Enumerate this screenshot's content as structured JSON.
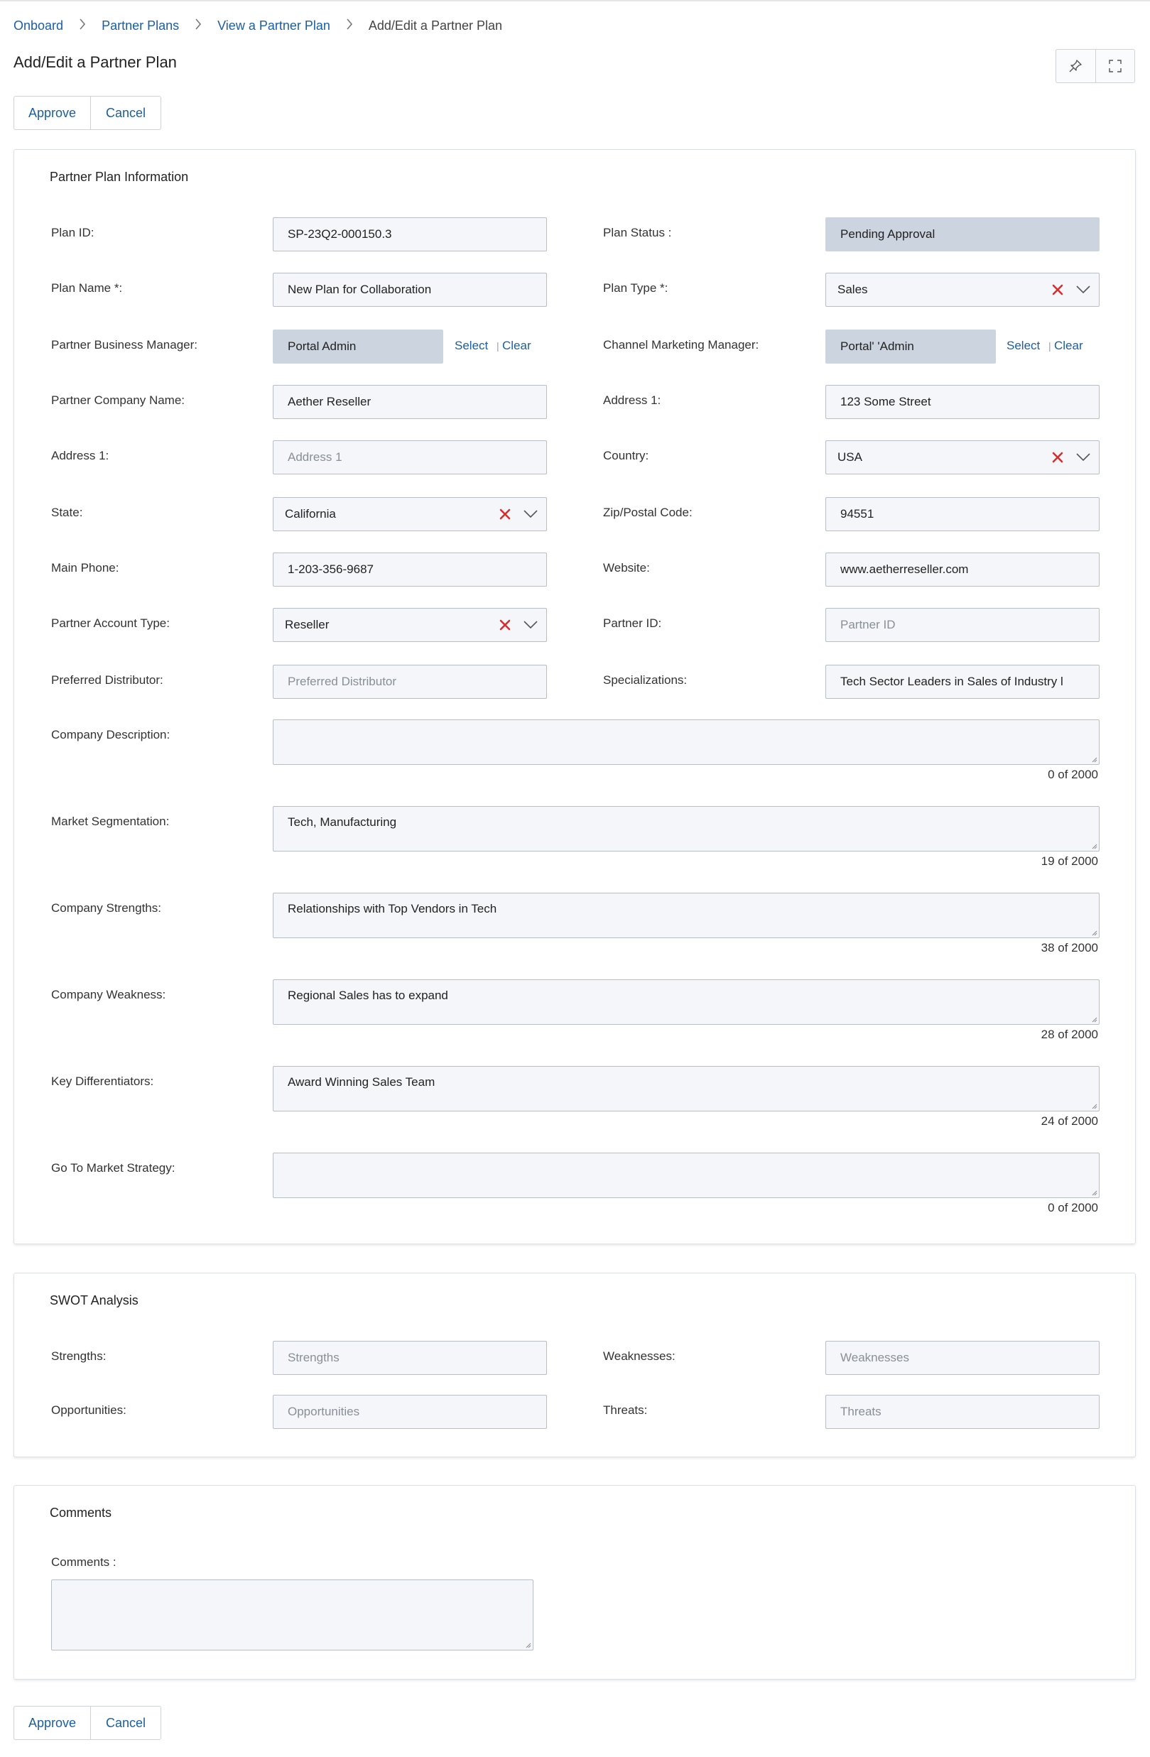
{
  "breadcrumb": {
    "items": [
      "Onboard",
      "Partner Plans",
      "View a Partner Plan"
    ],
    "current": "Add/Edit a Partner Plan"
  },
  "page": {
    "title": "Add/Edit a Partner Plan"
  },
  "header_icons": [
    "pin-icon",
    "fullscreen-icon"
  ],
  "actions": {
    "approve": "Approve",
    "cancel": "Cancel"
  },
  "plan_info": {
    "title": "Partner Plan Information",
    "plan_id": {
      "label": "Plan ID:",
      "value": "SP-23Q2-000150.3"
    },
    "plan_status": {
      "label": "Plan Status :",
      "value": "Pending Approval"
    },
    "plan_name": {
      "label": "Plan Name *:",
      "value": "New Plan for Collaboration"
    },
    "plan_type": {
      "label": "Plan Type *:",
      "value": "Sales"
    },
    "pbm": {
      "label": "Partner Business Manager:",
      "value": "Portal Admin",
      "select": "Select",
      "clear": "Clear"
    },
    "cmm": {
      "label": "Channel Marketing Manager:",
      "value": "Portal' 'Admin",
      "select": "Select",
      "clear": "Clear"
    },
    "company_name": {
      "label": "Partner Company Name:",
      "value": "Aether Reseller"
    },
    "address1_right": {
      "label": "Address 1:",
      "value": "123 Some Street"
    },
    "address1_left": {
      "label": "Address 1:",
      "placeholder": "Address 1"
    },
    "country": {
      "label": "Country:",
      "value": "USA"
    },
    "state": {
      "label": "State:",
      "value": "California"
    },
    "zip": {
      "label": "Zip/Postal Code:",
      "value": "94551"
    },
    "phone": {
      "label": "Main Phone:",
      "value": "1-203-356-9687"
    },
    "website": {
      "label": "Website:",
      "value": "www.aetherreseller.com"
    },
    "account_type": {
      "label": "Partner Account Type:",
      "value": "Reseller"
    },
    "partner_id": {
      "label": "Partner ID:",
      "placeholder": "Partner ID"
    },
    "distributor": {
      "label": "Preferred Distributor:",
      "placeholder": "Preferred Distributor"
    },
    "specializations": {
      "label": "Specializations:",
      "value": "Tech Sector Leaders in Sales of Industry l"
    },
    "company_description": {
      "label": "Company Description:",
      "value": "",
      "counter": "0 of 2000"
    },
    "market_segmentation": {
      "label": "Market Segmentation:",
      "value": "Tech, Manufacturing",
      "counter": "19 of 2000"
    },
    "company_strengths": {
      "label": "Company Strengths:",
      "value": "Relationships with Top Vendors in Tech",
      "counter": "38 of 2000"
    },
    "company_weakness": {
      "label": "Company Weakness:",
      "value": "Regional Sales has to expand",
      "counter": "28 of 2000"
    },
    "key_differentiators": {
      "label": "Key Differentiators:",
      "value": "Award Winning Sales Team",
      "counter": "24 of 2000"
    },
    "gtm_strategy": {
      "label": "Go To Market Strategy:",
      "value": "",
      "counter": "0 of 2000"
    }
  },
  "swot": {
    "title": "SWOT Analysis",
    "strengths": {
      "label": "Strengths:",
      "placeholder": "Strengths"
    },
    "weaknesses": {
      "label": "Weaknesses:",
      "placeholder": "Weaknesses"
    },
    "opportunities": {
      "label": "Opportunities:",
      "placeholder": "Opportunities"
    },
    "threats": {
      "label": "Threats:",
      "placeholder": "Threats"
    }
  },
  "comments": {
    "title": "Comments",
    "label": "Comments :",
    "value": ""
  },
  "colors": {
    "link": "#1a5fa3",
    "clear_x": "#d32f2f",
    "field_bg": "#f4f6f9",
    "readonly_bg": "#ccd4df",
    "border": "#b8bec6"
  }
}
